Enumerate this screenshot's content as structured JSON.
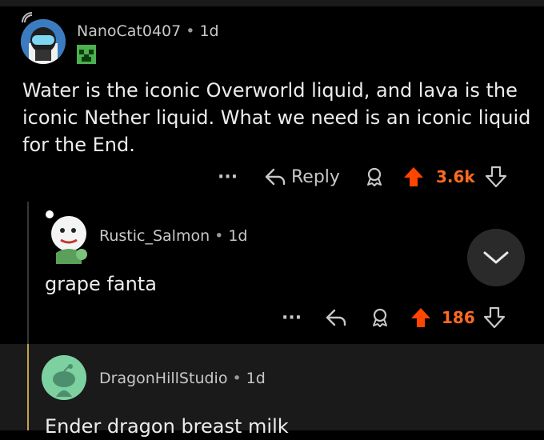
{
  "comment1": {
    "username": "NanoCat0407",
    "age": "1d",
    "body": "Water is the iconic Overworld liquid, and lava is the iconic Nether liquid. What we need is an iconic liquid for the End.",
    "reply_label": "Reply",
    "more_label": "···",
    "votes": "3.6k",
    "flair_icon": "creeper-flair-icon"
  },
  "comment2": {
    "username": "Rustic_Salmon",
    "age": "1d",
    "body": "grape fanta",
    "more_label": "···",
    "votes": "186"
  },
  "comment3": {
    "username": "DragonHillStudio",
    "age": "1d",
    "body": "Ender dragon breast milk"
  },
  "colors": {
    "upvote": "#ff4500",
    "thread_highlight": "#c8a24a",
    "background": "#000000",
    "panel": "#1a1a1b"
  }
}
